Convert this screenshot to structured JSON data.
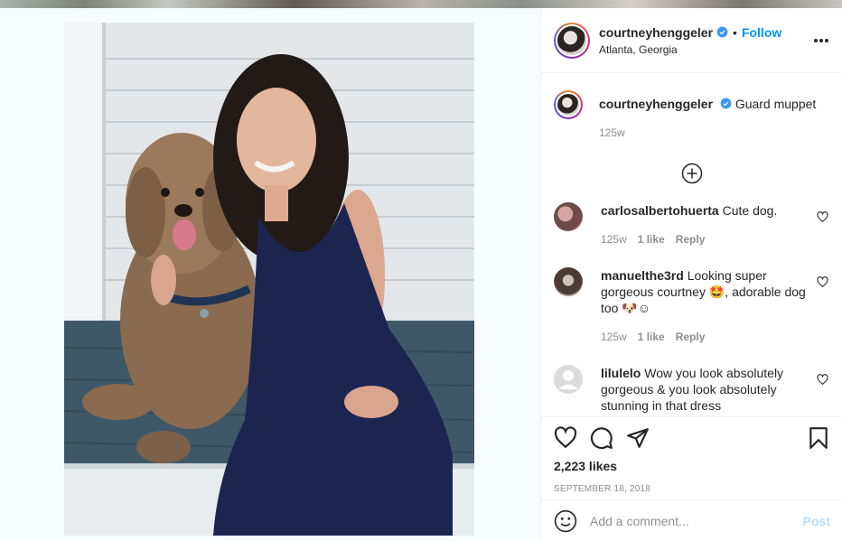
{
  "post": {
    "username": "courtneyhenggeler",
    "location": "Atlanta, Georgia",
    "follow_label": "Follow",
    "dot": "•",
    "caption": "Guard muppet",
    "caption_time": "125w",
    "likes": "2,223 likes",
    "date": "SEPTEMBER 18, 2018"
  },
  "comments": [
    {
      "username": "carlosalbertohuerta",
      "text": "Cute dog.",
      "time": "125w",
      "likes": "1 like",
      "reply": "Reply"
    },
    {
      "username": "manuelthe3rd",
      "text": "Looking super gorgeous courtney 🤩, adorable dog too 🐶☺",
      "time": "125w",
      "likes": "1 like",
      "reply": "Reply"
    },
    {
      "username": "lilulelo",
      "text": "Wow you look absolutely gorgeous & you look absolutely stunning in that dress",
      "time": "",
      "likes": "",
      "reply": ""
    }
  ],
  "composer": {
    "placeholder": "Add a comment...",
    "post_label": "Post"
  },
  "icons": {
    "more": "more-options-icon",
    "verified": "verified-badge-icon",
    "load_more": "plus-circle-icon",
    "like": "heart-icon",
    "comment": "comment-bubble-icon",
    "share": "paper-plane-icon",
    "save": "bookmark-icon",
    "emoji": "smiley-icon"
  },
  "colors": {
    "accent": "#0095f6",
    "post_disabled": "#b2dffc",
    "muted": "#8e8e8e",
    "text": "#262626"
  }
}
